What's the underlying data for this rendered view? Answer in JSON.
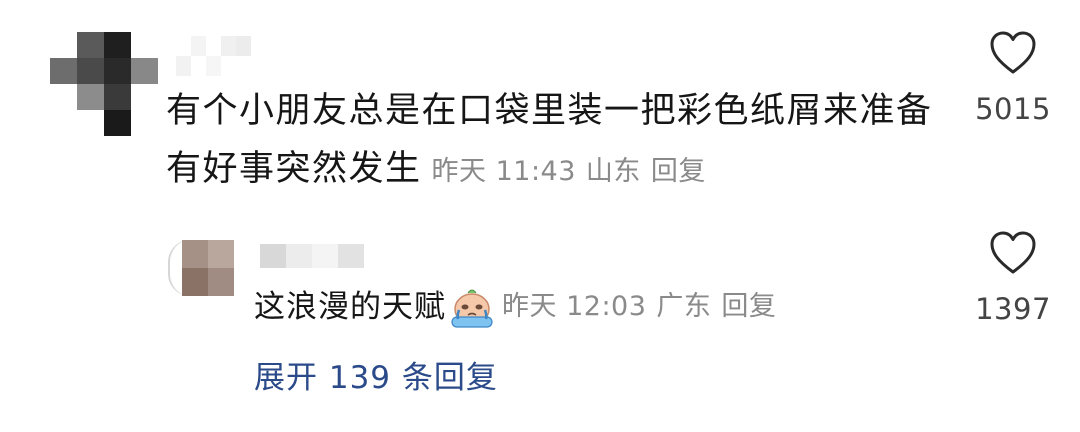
{
  "comment": {
    "text": "有个小朋友总是在口袋里装一把彩色纸屑来准备有好事突然发生",
    "time": "昨天 11:43",
    "location": "山东",
    "reply_label": "回复",
    "likes": "5015"
  },
  "reply": {
    "text": "这浪漫的天赋",
    "emoji": "crying-face-emoji",
    "time": "昨天 12:03",
    "location": "广东",
    "reply_label": "回复",
    "likes": "1397"
  },
  "expand": {
    "label": "展开 139 条回复"
  },
  "icons": {
    "like": "heart-outline-icon"
  },
  "colors": {
    "link": "#2b4a8a",
    "meta": "#8a8a8a",
    "text": "#161616"
  }
}
